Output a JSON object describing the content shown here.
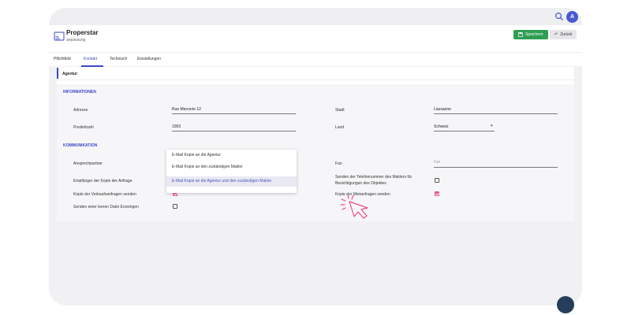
{
  "header": {
    "title": "Properstar",
    "subtitle": "anpassung",
    "save_label": "Speichern",
    "back_label": "Zurück",
    "avatar_initials": "A"
  },
  "tabs": [
    {
      "label": "Pflichtfeld"
    },
    {
      "label": "Kontakt"
    },
    {
      "label": "Technisch"
    },
    {
      "label": "Einstellungen"
    }
  ],
  "active_tab": "Kontakt",
  "section": {
    "title": "Agentur",
    "info_heading": "INFORMATIONEN",
    "komm_heading": "KOMMUNIKATION"
  },
  "fields": {
    "adresse": {
      "label": "Adresse",
      "value": "Rue Mercerie 12"
    },
    "stadt": {
      "label": "Stadt",
      "value": "Lausanne"
    },
    "postleitzahl": {
      "label": "Postleitzahl",
      "value": "1003"
    },
    "land": {
      "label": "Land",
      "value": "Schweiz"
    },
    "ansprechpartner": {
      "label": "Ansprechpartner"
    },
    "fax": {
      "label": "Fax",
      "placeholder": "Fax"
    },
    "empfaenger": {
      "label": "Empfänger der Kopie der Anfrage"
    },
    "telefonnummer": {
      "label_line1": "Senden der Telefonnummer des Maklers für",
      "label_line2": "Besichtigungen des Objektes",
      "checked": false
    },
    "kopie_verkauf": {
      "label": "Kopie der Verkaufsanfragen senden",
      "checked": true
    },
    "kopie_miet": {
      "label": "Kopie der Mietanfragen senden",
      "checked": true
    },
    "leere_datei": {
      "label": "Senden einer leeren Datei Erzwingen",
      "checked": false
    }
  },
  "dropdown": {
    "options": [
      "E-Mail Kopie an die Agentur",
      "E-Mail Kopie an den zuständigen Makler",
      "E-Mail Kopie an die Agentur und den zuständigen Makler"
    ],
    "selected_index": 2
  },
  "colors": {
    "accent": "#3a48c8",
    "save_green": "#2e9e52",
    "checkbox_pink": "#e75b8e"
  }
}
